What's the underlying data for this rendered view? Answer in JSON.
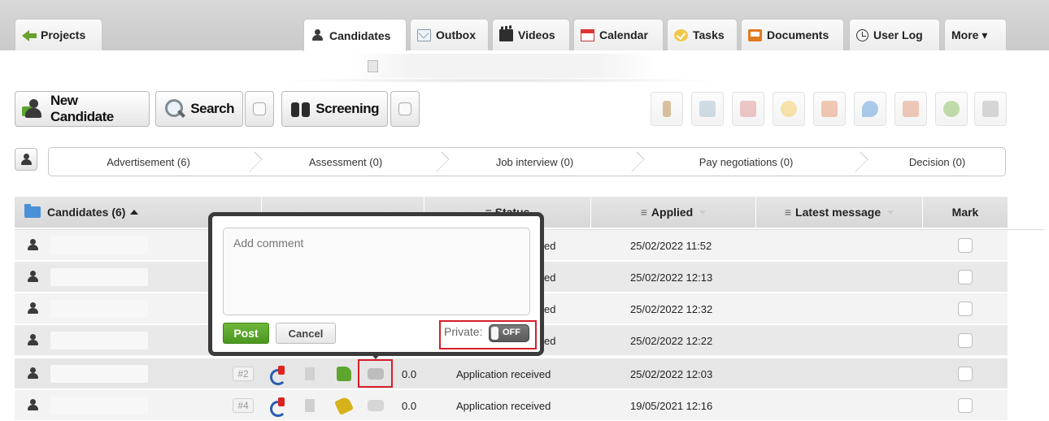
{
  "tabs": {
    "projects": "Projects",
    "candidates": "Candidates",
    "outbox": "Outbox",
    "videos": "Videos",
    "calendar": "Calendar",
    "tasks": "Tasks",
    "documents": "Documents",
    "user_log": "User Log",
    "more": "More ▾"
  },
  "toolbar": {
    "new_candidate": "New Candidate",
    "search": "Search",
    "screening": "Screening"
  },
  "pipeline": {
    "stages": [
      "Advertisement (6)",
      "Assessment (0)",
      "Job interview (0)",
      "Pay negotiations (0)",
      "Decision (0)"
    ]
  },
  "table": {
    "headers": {
      "candidates": "Candidates (6)",
      "status": "≡ Status",
      "applied": "Applied",
      "latest_message": "Latest message",
      "mark": "Mark"
    },
    "hamburger": "≡",
    "rows": [
      {
        "status": "Application received",
        "applied": "25/02/2022 11:52"
      },
      {
        "status": "Application received",
        "applied": "25/02/2022 12:13"
      },
      {
        "status": "Application received",
        "applied": "25/02/2022 12:32"
      },
      {
        "status": "Application received",
        "applied": "25/02/2022 12:22"
      },
      {
        "rank": "#2",
        "score": "0.0",
        "status": "Application received",
        "applied": "25/02/2022 12:03"
      },
      {
        "rank": "#4",
        "score": "0.0",
        "status": "Application received",
        "applied": "19/05/2021 12:16"
      }
    ],
    "status_suffix": "ed"
  },
  "popup": {
    "placeholder": "Add comment",
    "post": "Post",
    "cancel": "Cancel",
    "private_label": "Private:",
    "toggle_state": "OFF"
  },
  "colors": {
    "accent_green": "#5ea52e",
    "highlight_red": "#d61e2a",
    "popup_border": "#3a3a3a"
  }
}
